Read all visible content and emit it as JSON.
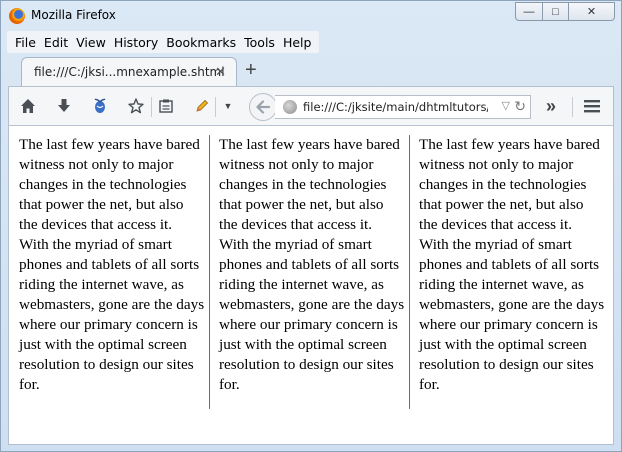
{
  "window": {
    "title": "Mozilla Firefox"
  },
  "window_controls": {
    "minimize": "—",
    "maximize": "□",
    "close": "✕"
  },
  "menu": [
    {
      "label": "File"
    },
    {
      "label": "Edit"
    },
    {
      "label": "View"
    },
    {
      "label": "History"
    },
    {
      "label": "Bookmarks"
    },
    {
      "label": "Tools"
    },
    {
      "label": "Help"
    }
  ],
  "tab": {
    "title": "file:///C:/jksi...mnexample.shtml",
    "close": "✕"
  },
  "new_tab": "+",
  "toolbar": {
    "icons": [
      "home-icon",
      "download-icon",
      "firebug-icon",
      "bookmark-star-icon",
      "reading-list-icon",
      "pencil-icon",
      "dropdown-icon"
    ],
    "more": "»",
    "menu": "☰"
  },
  "urlbar": {
    "value": "file:///C:/jksite/main/dhtmltutors/css"
  },
  "content": {
    "column_text": "The last few years have bared witness not only to major changes in the technologies that power the net, but also the devices that access it. With the myriad of smart phones and tablets of all sorts riding the internet wave, as webmasters, gone are the days where our primary concern is just with the optimal screen resolution to design our sites for.",
    "column_rule_color": "#b5562a"
  }
}
